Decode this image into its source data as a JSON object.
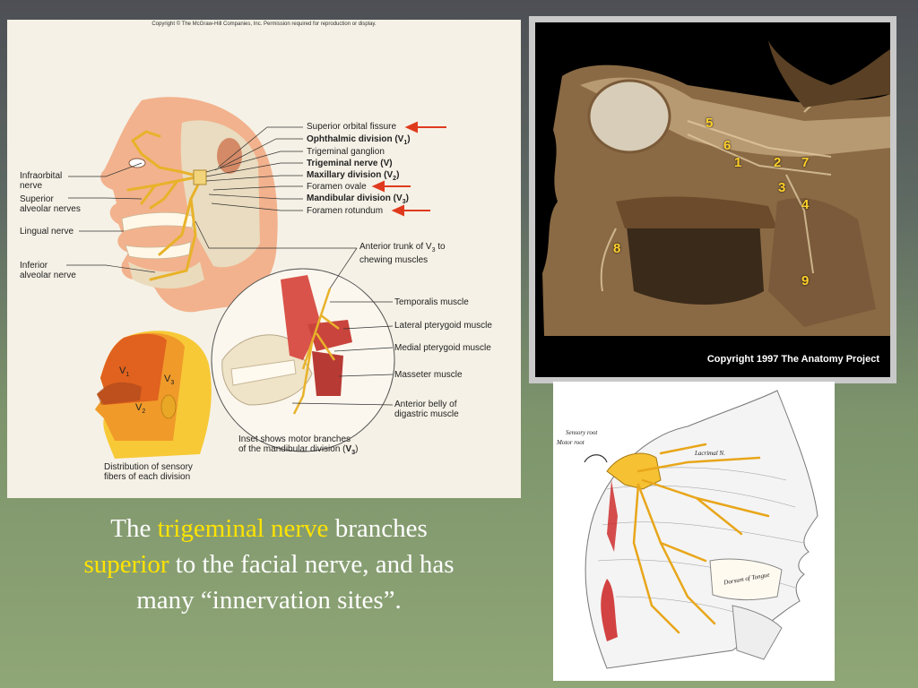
{
  "left_figure": {
    "copyright": "Copyright © The McGraw-Hill Companies, Inc. Permission required for reproduction or display.",
    "right_labels": {
      "superior_orbital_fissure": "Superior orbital fissure",
      "ophthalmic_division": "Ophthalmic division (V",
      "ophthalmic_sub": "1",
      "trigeminal_ganglion": "Trigeminal ganglion",
      "trigeminal_nerve": "Trigeminal nerve (V)",
      "maxillary_division": "Maxillary division (V",
      "maxillary_sub": "2",
      "foramen_ovale": "Foramen ovale",
      "mandibular_division": "Mandibular division (V",
      "mandibular_sub": "3",
      "foramen_rotundum": "Foramen rotundum"
    },
    "left_labels": {
      "infraorbital_1": "Infraorbital",
      "infraorbital_2": "nerve",
      "superior_alveolar_1": "Superior",
      "superior_alveolar_2": "alveolar nerves",
      "lingual": "Lingual nerve",
      "inferior_alveolar_1": "Inferior",
      "inferior_alveolar_2": "alveolar nerve"
    },
    "anterior_trunk_1": "Anterior trunk of V",
    "anterior_trunk_sub": "3",
    "anterior_trunk_2": " to",
    "anterior_trunk_3": "chewing muscles",
    "muscle_labels": {
      "temporalis": "Temporalis muscle",
      "lateral_pterygoid": "Lateral pterygoid muscle",
      "medial_pterygoid": "Medial pterygoid muscle",
      "masseter": "Masseter muscle",
      "digastric_1": "Anterior belly of",
      "digastric_2": "digastric muscle"
    },
    "inset_caption_1": "Inset shows motor branches",
    "inset_caption_2": "of the mandibular division (",
    "inset_caption_bold": "V",
    "inset_caption_sub": "3",
    "inset_caption_end": ")",
    "sensory_caption_1": "Distribution of sensory",
    "sensory_caption_2": "fibers of each division",
    "head_regions": {
      "v1": "V",
      "v1_sub": "1",
      "v2": "V",
      "v2_sub": "2",
      "v3": "V",
      "v3_sub": "3"
    },
    "colors": {
      "v1": "#e0621e",
      "v2": "#f09a2a",
      "v3": "#f7c936",
      "arrow": "#e03a1e",
      "nerve": "#e8b22a"
    }
  },
  "dissection_photo": {
    "numbers": [
      "5",
      "6",
      "1",
      "2",
      "7",
      "3",
      "4",
      "8",
      "9"
    ],
    "copyright": "Copyright 1997 The Anatomy Project"
  },
  "gray_figure": {
    "sensory_root": "Sensory root",
    "motor_root": "Motor root",
    "lacrimal": "Lacrimal N.",
    "tongue": "Dorsum of Tongue"
  },
  "caption": {
    "part1": "The ",
    "hl1": "trigeminal nerve",
    "part2": " branches",
    "hl2": "superior",
    "part3": " to the facial nerve, and has",
    "part4": "many “innervation sites”."
  }
}
